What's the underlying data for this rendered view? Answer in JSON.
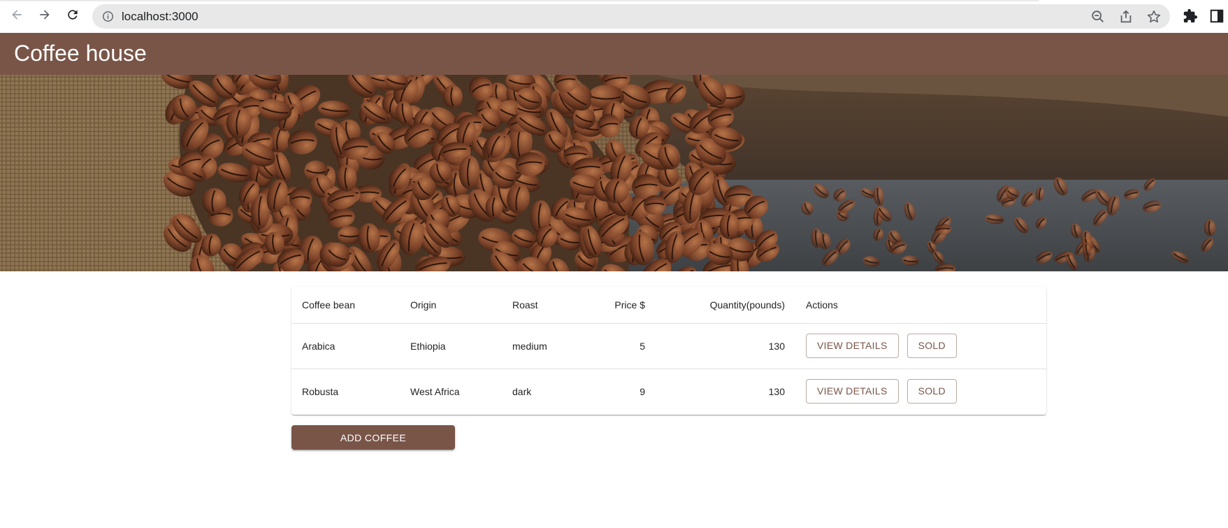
{
  "browser": {
    "url": "localhost:3000",
    "icons": [
      "back-icon",
      "forward-icon",
      "reload-icon",
      "info-icon",
      "zoom-out-icon",
      "share-icon",
      "star-icon",
      "extensions-icon",
      "side-panel-icon"
    ]
  },
  "appbar": {
    "title": "Coffee house",
    "color": "#795548"
  },
  "table": {
    "headers": {
      "bean": "Coffee bean",
      "origin": "Origin",
      "roast": "Roast",
      "price": "Price $",
      "quantity": "Quantity(pounds)",
      "actions": "Actions"
    },
    "rows": [
      {
        "bean": "Arabica",
        "origin": "Ethiopia",
        "roast": "medium",
        "price": "5",
        "quantity": "130",
        "details_label": "VIEW DETAILS",
        "sold_label": "SOLD"
      },
      {
        "bean": "Robusta",
        "origin": "West Africa",
        "roast": "dark",
        "price": "9",
        "quantity": "130",
        "details_label": "VIEW DETAILS",
        "sold_label": "SOLD"
      }
    ]
  },
  "add_button": {
    "label": "ADD COFFEE"
  },
  "colors": {
    "primary": "#795548",
    "text": "#202124"
  }
}
